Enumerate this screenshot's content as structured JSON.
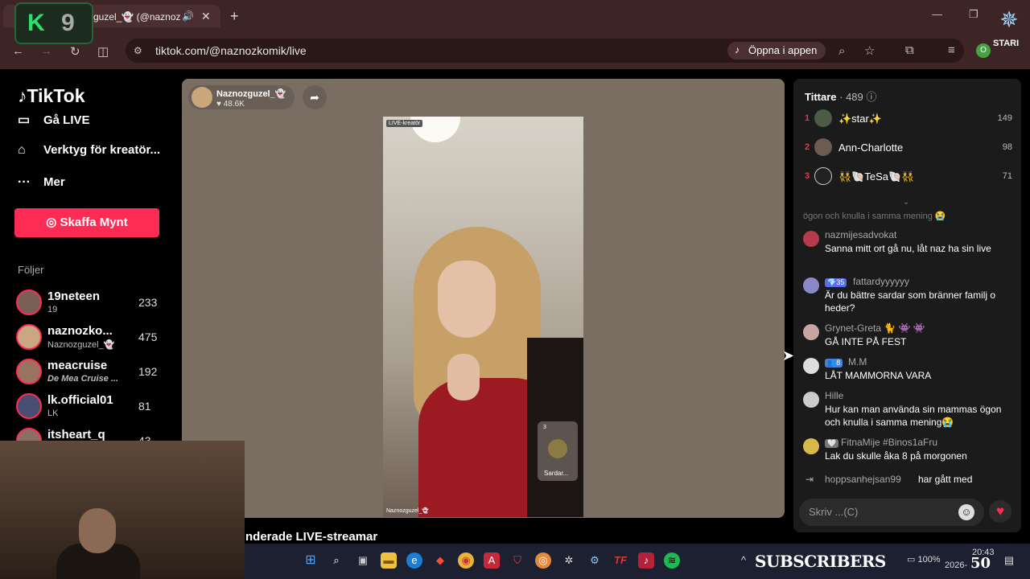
{
  "browser": {
    "tab_title": "guzel_👻 (@naznoz",
    "url": "tiktok.com/@naznozkomik/live",
    "open_app_label": "Öppna i appen",
    "profile_initial": "O"
  },
  "overlay": {
    "k9_letter": "K",
    "k9_number": "9",
    "star_label": "STARI"
  },
  "tiktok": {
    "logo": "TikTok",
    "nav": [
      {
        "label": "Gå LIVE",
        "icon": "video-camera-icon"
      },
      {
        "label": "Verktyg för kreatör...",
        "icon": "creator-tools-icon"
      },
      {
        "label": "Mer",
        "icon": "more-dots-icon"
      }
    ],
    "coins_button": "Skaffa Mynt",
    "following_header": "Följer",
    "following": [
      {
        "name": "19neteen",
        "sub": "19",
        "count": "233"
      },
      {
        "name": "naznozko...",
        "sub": "Naznozguzel_👻",
        "count": "475"
      },
      {
        "name": "meacruise",
        "sub": "De Mea Cruise ...",
        "count": "192"
      },
      {
        "name": "lk.official01",
        "sub": "LK",
        "count": "81"
      },
      {
        "name": "itsheart_q",
        "sub": "",
        "count": "43"
      }
    ]
  },
  "stream": {
    "host_name": "Naznozguzel_👻",
    "host_likes": "♥ 48.6K",
    "live_badge": "LIVE-kreatör",
    "guest_name": "Sardar...",
    "guest_count": "3",
    "video_watermark": "Naznozguzel_👻",
    "below_title": "nderade LIVE-streamar"
  },
  "viewers": {
    "label": "Tittare",
    "count": "· 489",
    "top": [
      {
        "rank": "1",
        "name": "✨star✨",
        "score": "149"
      },
      {
        "rank": "2",
        "name": "Ann-Charlotte",
        "score": "98"
      },
      {
        "rank": "3",
        "name": "👯🐚TeSa🐚👯",
        "score": "71"
      }
    ]
  },
  "chat": {
    "fade_line": "ögon och knulla i samma mening 😭",
    "messages": [
      {
        "user": "nazmijesadvokat",
        "badge": "",
        "text": "Sanna mitt ort gå nu, låt naz ha sin live"
      },
      {
        "user": "fattardyyyyyy",
        "badge": "💎35",
        "text": "Är du bättre sardar som bränner familj o heder?"
      },
      {
        "user": "Grynet-Greta 🐈 👾 👾",
        "badge": "",
        "text": "GÅ INTE PÅ FEST"
      },
      {
        "user": "M.M",
        "badge": "👥8",
        "text": "LÅT MAMMORNA VARA"
      },
      {
        "user": "Hille",
        "badge": "",
        "text": "Hur kan man använda sin mammas ögon och knulla i samma mening😭"
      },
      {
        "user": "FitnaMije #Binos1aFru",
        "badge": "🤍",
        "text": "Lak du skulle åka 8 på morgonen"
      }
    ],
    "joined_user": "hoppsanhejsan99",
    "joined_text": "har gått med",
    "input_placeholder": "Skriv ...(C)"
  },
  "taskbar": {
    "subscribers": "SUBSCRIBERS",
    "subscribers_count": "50",
    "battery": "100%",
    "time": "20:43",
    "date": "2026-"
  }
}
